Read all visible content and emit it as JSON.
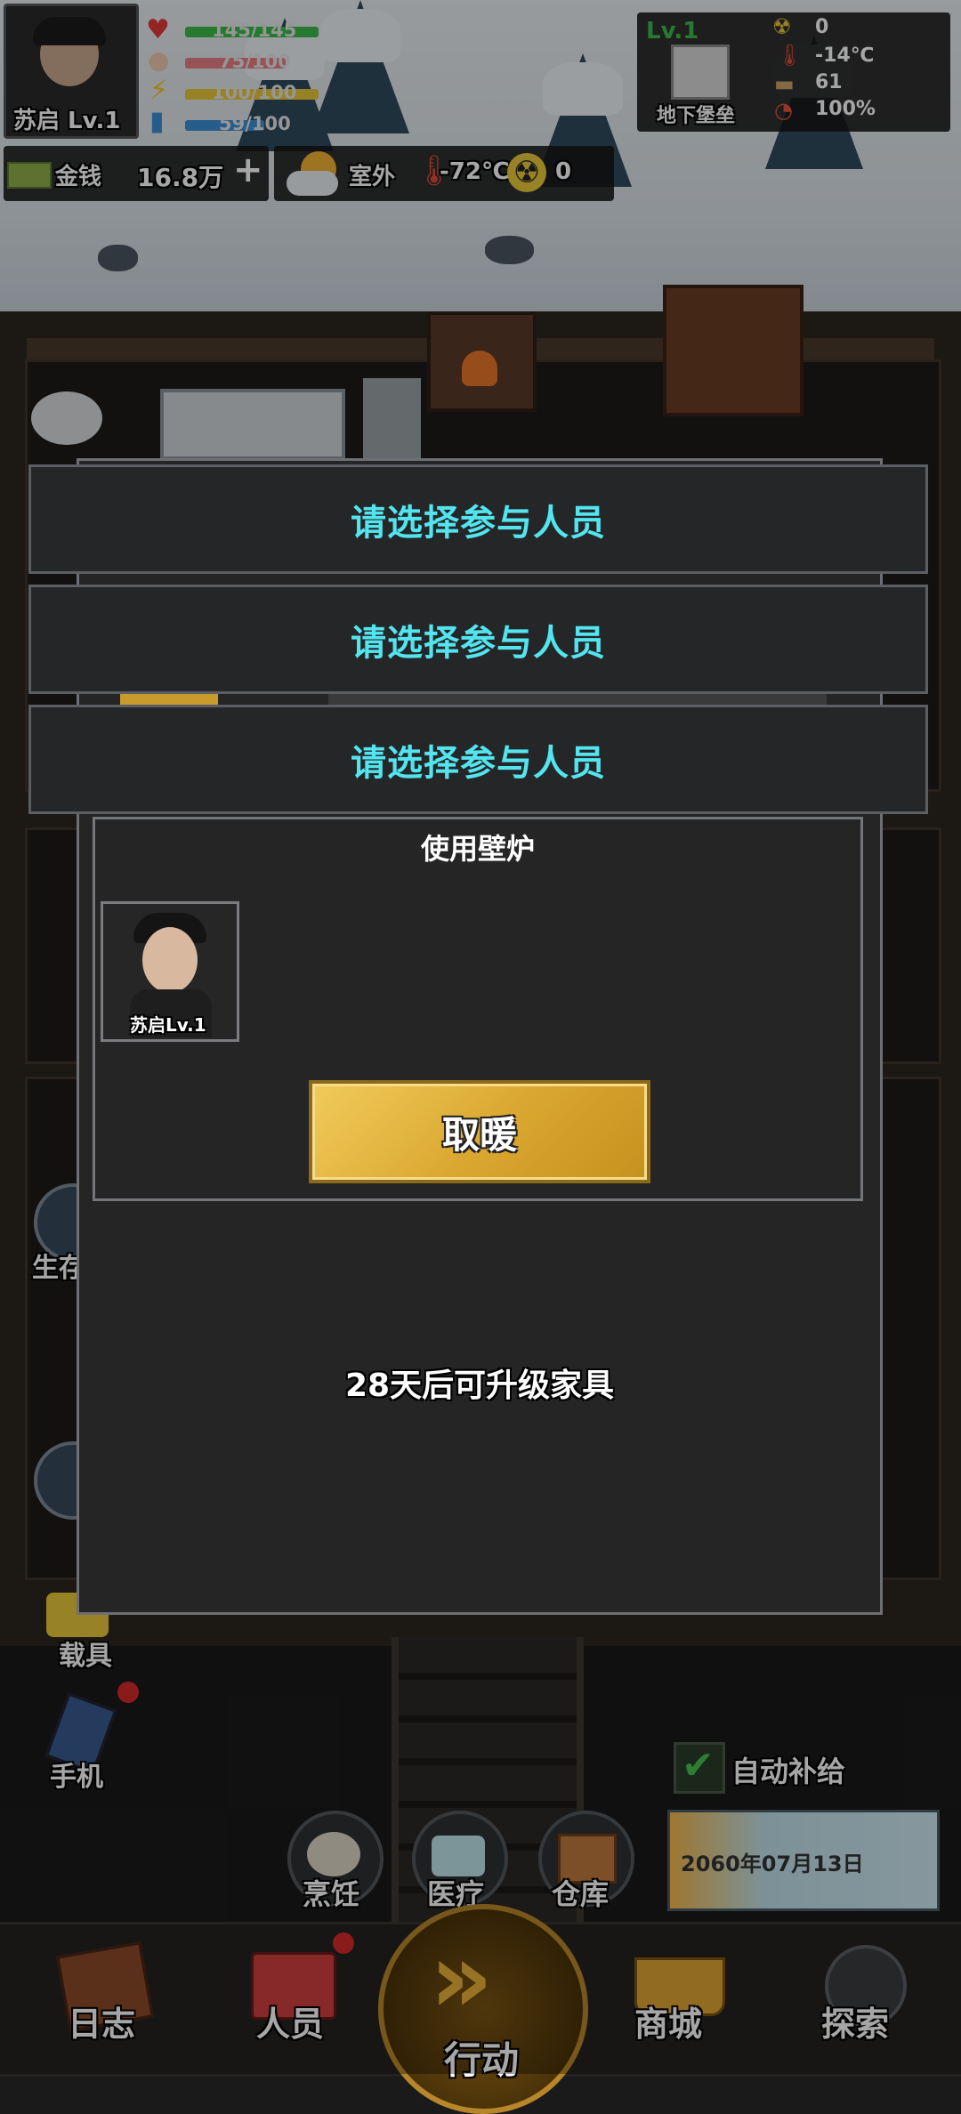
{
  "player": {
    "name_level": "苏启 Lv.1",
    "hp": "145/145",
    "food": "75/100",
    "energy": "100/100",
    "water": "59/100"
  },
  "money": {
    "label": "金钱",
    "value": "16.8万",
    "add": "+"
  },
  "outdoor": {
    "label": "室外",
    "temperature": "-72℃",
    "radiation": "0"
  },
  "base": {
    "level": "Lv.1",
    "name": "地下堡垒",
    "radiation": "0",
    "temperature": "-14℃",
    "supplies": "61",
    "integrity": "100%"
  },
  "banners": [
    "请选择参与人员",
    "请选择参与人员",
    "请选择参与人员"
  ],
  "furniture_dialog": {
    "title": "使用壁炉",
    "participant": "苏启Lv.1",
    "action_button": "取暖",
    "upgrade_note": "28天后可升级家具"
  },
  "side_menu": [
    "生存",
    "载具",
    "手机"
  ],
  "auto_supply": {
    "label": "自动补给",
    "checked": true
  },
  "date": "2060年07月13日",
  "quick_actions": [
    "烹饪",
    "医疗",
    "仓库"
  ],
  "bottom_nav": [
    "日志",
    "人员",
    "行动",
    "商城",
    "探索"
  ],
  "colors": {
    "accent_cyan": "#53e5ef",
    "gold": "#d9a62e",
    "hp_bar": "#3cba4a",
    "food_bar": "#e77f86",
    "energy_bar": "#e8c83a",
    "water_bar": "#3b8fd6"
  }
}
